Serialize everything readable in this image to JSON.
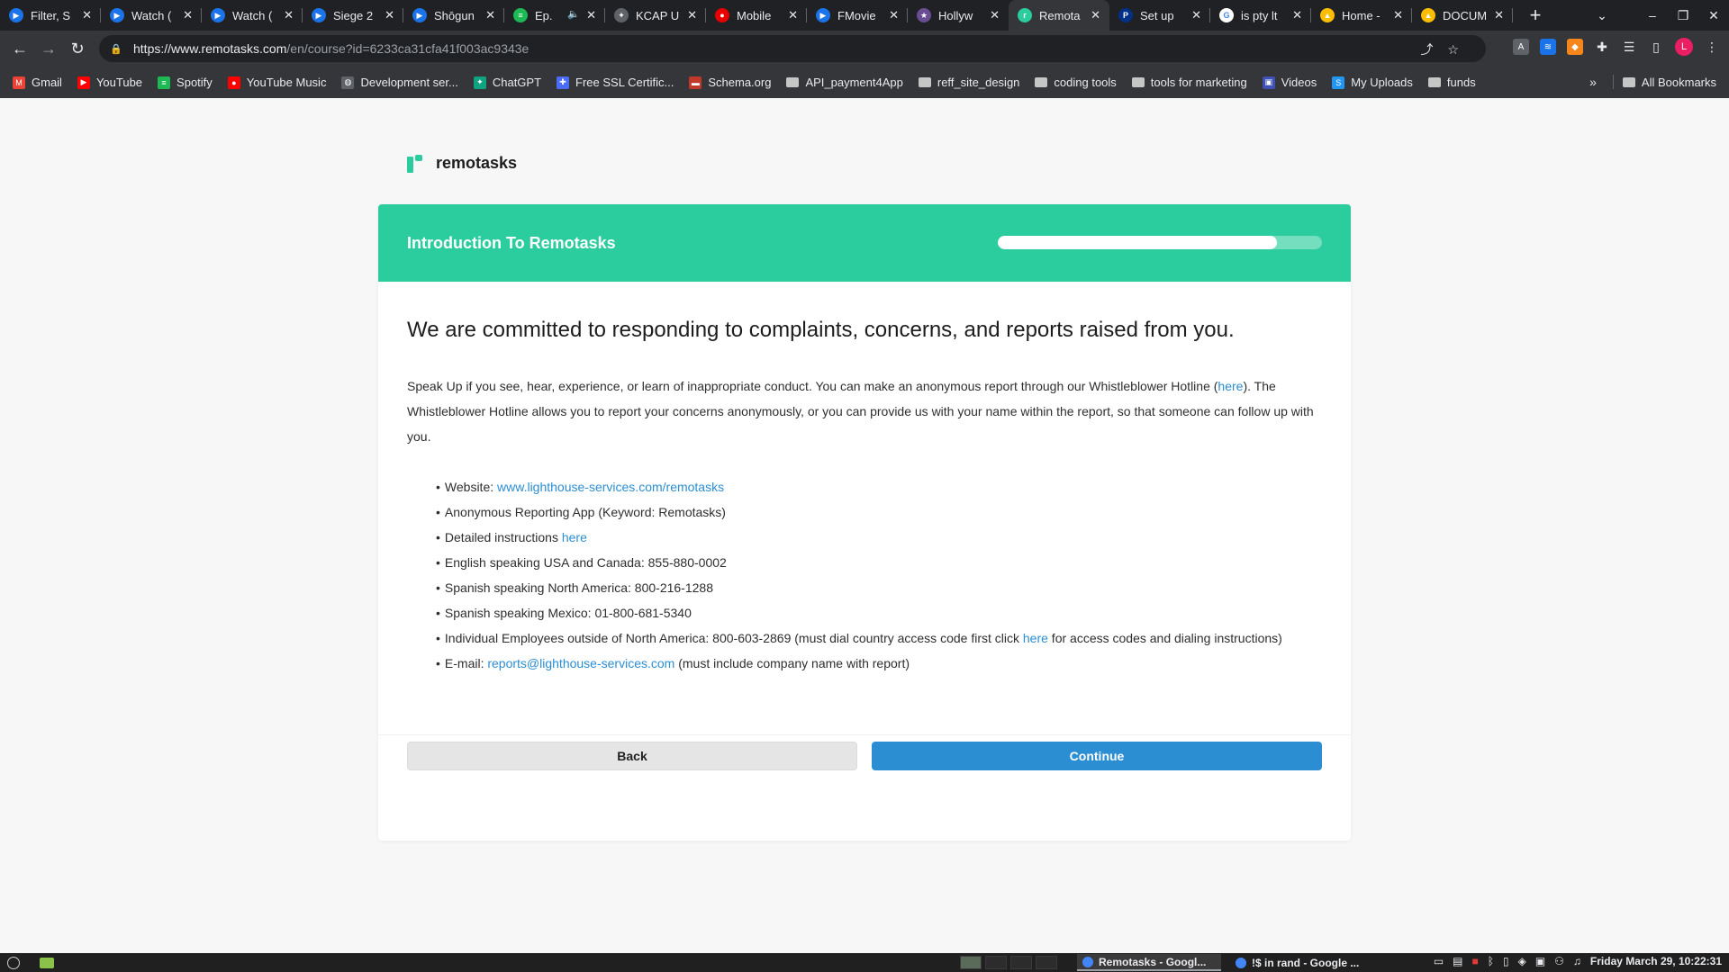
{
  "browser": {
    "tabs": [
      {
        "title": "Filter, S",
        "fav_color": "#1a73e8",
        "fav_glyph": "▶"
      },
      {
        "title": "Watch (",
        "fav_color": "#1a73e8",
        "fav_glyph": "▶"
      },
      {
        "title": "Watch (",
        "fav_color": "#1a73e8",
        "fav_glyph": "▶"
      },
      {
        "title": "Siege 2",
        "fav_color": "#1a73e8",
        "fav_glyph": "▶"
      },
      {
        "title": "Shōgun",
        "fav_color": "#1a73e8",
        "fav_glyph": "▶"
      },
      {
        "title": "Ep.",
        "fav_color": "#1db954",
        "fav_glyph": "≡"
      },
      {
        "title": "KCAP U",
        "fav_color": "#5f6368",
        "fav_glyph": "✦"
      },
      {
        "title": "Mobile",
        "fav_color": "#e60000",
        "fav_glyph": "●"
      },
      {
        "title": "FMovie",
        "fav_color": "#1a73e8",
        "fav_glyph": "▶"
      },
      {
        "title": "Hollyw",
        "fav_color": "#6a4c93",
        "fav_glyph": "★"
      },
      {
        "title": "Remota",
        "fav_color": "#2bcc9d",
        "fav_glyph": "r"
      },
      {
        "title": "Set up",
        "fav_color": "#003087",
        "fav_glyph": "P"
      },
      {
        "title": "is pty lt",
        "fav_color": "#ffffff",
        "fav_glyph": "G"
      },
      {
        "title": "Home -",
        "fav_color": "#fbbc04",
        "fav_glyph": "▲"
      },
      {
        "title": "DOCUM",
        "fav_color": "#fbbc04",
        "fav_glyph": "▲"
      }
    ],
    "active_tab_index": 10,
    "url_host": "https://www.remotasks.com",
    "url_path": "/en/course?id=6233ca31cfa41f003ac9343e",
    "profile_initial": "L",
    "bookmarks": [
      {
        "label": "Gmail",
        "icon": "gmail-icon",
        "color": "#ea4335",
        "glyph": "M"
      },
      {
        "label": "YouTube",
        "icon": "youtube-icon",
        "color": "#ff0000",
        "glyph": "▶"
      },
      {
        "label": "Spotify",
        "icon": "spotify-icon",
        "color": "#1db954",
        "glyph": "≡"
      },
      {
        "label": "YouTube Music",
        "icon": "youtube-music-icon",
        "color": "#ff0000",
        "glyph": "●"
      },
      {
        "label": "Development ser...",
        "icon": "globe-icon",
        "color": "#5f6368",
        "glyph": "◍"
      },
      {
        "label": "ChatGPT",
        "icon": "chatgpt-icon",
        "color": "#10a37f",
        "glyph": "✦"
      },
      {
        "label": "Free SSL Certific...",
        "icon": "puzzle-icon",
        "color": "#4a6cf7",
        "glyph": "✚"
      },
      {
        "label": "Schema.org",
        "icon": "schema-icon",
        "color": "#c0392b",
        "glyph": "▬"
      },
      {
        "label": "API_payment4App",
        "icon": "folder-icon"
      },
      {
        "label": "reff_site_design",
        "icon": "folder-icon"
      },
      {
        "label": "coding tools",
        "icon": "folder-icon"
      },
      {
        "label": "tools for marketing",
        "icon": "folder-icon"
      },
      {
        "label": "Videos",
        "icon": "videos-icon",
        "color": "#3f51b5",
        "glyph": "▣"
      },
      {
        "label": "My Uploads",
        "icon": "uploads-icon",
        "color": "#2196f3",
        "glyph": "S"
      },
      {
        "label": "funds",
        "icon": "folder-icon"
      }
    ],
    "all_bookmarks_label": "All Bookmarks"
  },
  "page": {
    "brand": "remotasks",
    "course_title": "Introduction To Remotasks",
    "progress_fraction": 0.86,
    "headline": "We are committed to responding to complaints, concerns, and reports raised from you.",
    "para_part1": "Speak Up if you see, hear, experience, or learn of inappropriate conduct. You can make an anonymous report through our Whistleblower Hotline (",
    "para_link": "here",
    "para_part2": "). The Whistleblower Hotline allows you to report your concerns anonymously, or you can provide us with your name within the report, so that someone can follow up with you.",
    "items": {
      "website_label": "Website: ",
      "website_link": "www.lighthouse-services.com/remotasks",
      "app": "Anonymous Reporting App (Keyword: Remotasks)",
      "instructions_label": "Detailed instructions ",
      "instructions_link": "here",
      "english": "English speaking USA and Canada: 855-880-0002",
      "spanish_na": "Spanish speaking North America: 800-216-1288",
      "spanish_mx": "Spanish speaking Mexico: 01-800-681-5340",
      "intl_part1": "Individual Employees outside of North America: 800-603-2869 (must dial country access code first click ",
      "intl_link": "here",
      "intl_part2": " for access codes and dialing instructions)",
      "email_label": "E-mail: ",
      "email_link": "reports@lighthouse-services.com",
      "email_suffix": " (must include company name with report)"
    },
    "back_label": "Back",
    "continue_label": "Continue"
  },
  "taskbar": {
    "tasks": [
      "Remotasks - Googl...",
      "!$ in rand - Google ..."
    ],
    "clock": "Friday March 29, 10:22:31"
  }
}
